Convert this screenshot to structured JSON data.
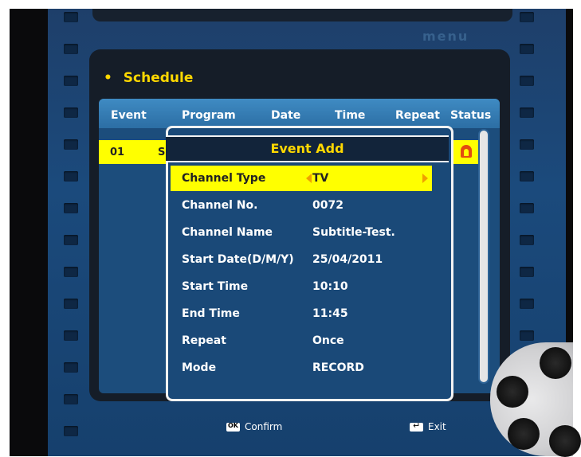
{
  "header": {
    "menu_logo": "menu",
    "title": "Schedule"
  },
  "table": {
    "columns": [
      "Event",
      "Program",
      "Date",
      "Time",
      "Repeat",
      "Status"
    ],
    "rows": [
      {
        "event": "01",
        "program": "S"
      }
    ]
  },
  "dialog": {
    "title": "Event Add",
    "fields": [
      {
        "label": "Channel Type",
        "value": "TV",
        "selected": true
      },
      {
        "label": "Channel No.",
        "value": "0072"
      },
      {
        "label": "Channel Name",
        "value": "Subtitle-Test."
      },
      {
        "label": "Start Date(D/M/Y)",
        "value": "25/04/2011"
      },
      {
        "label": "Start Time",
        "value": "10:10"
      },
      {
        "label": "End Time",
        "value": "11:45"
      },
      {
        "label": "Repeat",
        "value": "Once"
      },
      {
        "label": "Mode",
        "value": "RECORD"
      }
    ]
  },
  "footer": {
    "confirm_label": "Confirm",
    "exit_label": "Exit"
  },
  "colors": {
    "highlight": "#ffff00",
    "title_yellow": "#ffd800",
    "panel_blue": "#1c4d7c"
  },
  "icons": [
    "bullet-icon",
    "record-status-icon",
    "left-arrow-icon",
    "right-arrow-icon",
    "ok-key-icon",
    "exit-key-icon",
    "film-reel-icon"
  ]
}
